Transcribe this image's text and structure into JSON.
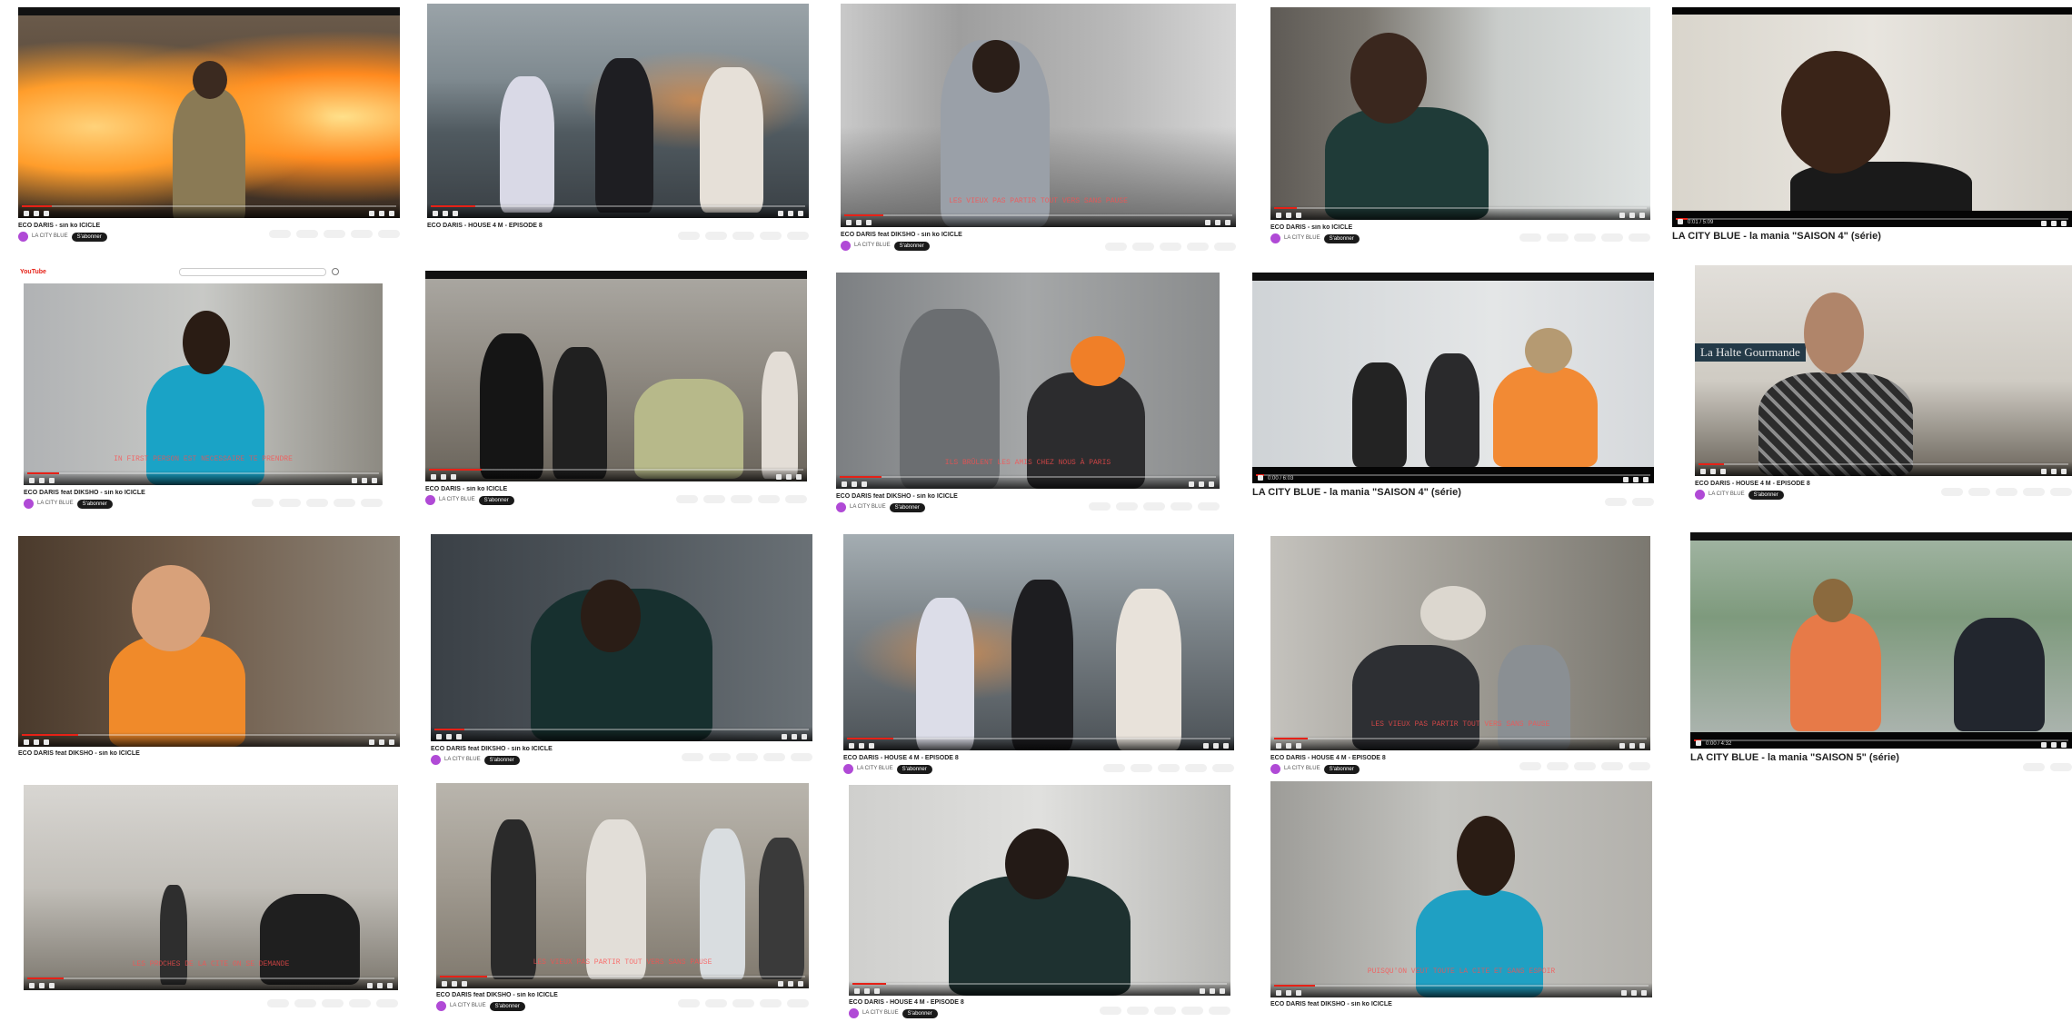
{
  "colors": {
    "progress": "#e62117",
    "subscribe": "#1a1a1a",
    "avatar": "#b04ad6",
    "caption": "#ff4d4d"
  },
  "search_bar": {
    "logo": "YouTube"
  },
  "videos": [
    {
      "title": "ECO DARIS - sin ko ICICLE",
      "channel": "LA CITY BLUE",
      "subscribe": "S'abonner",
      "caption": ""
    },
    {
      "title": "ECO DARIS - HOUSE 4 M - EPISODE 8",
      "channel": "",
      "subscribe": "",
      "caption": ""
    },
    {
      "title": "ECO DARIS feat DIKSHO - sin ko ICICLE",
      "channel": "LA CITY BLUE",
      "subscribe": "S'abonner",
      "caption": "LES VIEUX PAS PARTIR TOUT VERS SANS PAUSE"
    },
    {
      "title": "ECO DARIS - sin ko ICICLE",
      "channel": "LA CITY BLUE",
      "subscribe": "S'abonner",
      "caption": ""
    },
    {
      "title": "LA CITY BLUE - la mania \"SAISON 4\" (série)",
      "channel": "",
      "subscribe": "",
      "caption": "",
      "time": "0:01 / 5:09"
    },
    {
      "title": "ECO DARIS feat DIKSHO - sin ko ICICLE",
      "channel": "LA CITY BLUE",
      "subscribe": "S'abonner",
      "caption": "IN FIRST PERSON EST NÉCESSAIRE TE PRENDRE"
    },
    {
      "title": "ECO DARIS - sin ko ICICLE",
      "channel": "LA CITY BLUE",
      "subscribe": "S'abonner",
      "caption": ""
    },
    {
      "title": "ECO DARIS feat DIKSHO - sin ko ICICLE",
      "channel": "LA CITY BLUE",
      "subscribe": "S'abonner",
      "caption": "ILS BRÛLENT LES AMIS CHEZ NOUS À PARIS"
    },
    {
      "title": "LA CITY BLUE - la mania \"SAISON 4\" (série)",
      "channel": "",
      "subscribe": "",
      "caption": "",
      "time": "0:00 / 6:03"
    },
    {
      "title": "ECO DARIS - HOUSE 4 M - EPISODE 8",
      "channel": "LA CITY BLUE",
      "subscribe": "S'abonner",
      "caption": "",
      "sign": "La Halte Gourmande"
    },
    {
      "title": "ECO DARIS feat DIKSHO - sin ko ICICLE",
      "channel": "",
      "subscribe": "",
      "caption": ""
    },
    {
      "title": "ECO DARIS feat DIKSHO - sin ko ICICLE",
      "channel": "LA CITY BLUE",
      "subscribe": "S'abonner",
      "caption": ""
    },
    {
      "title": "ECO DARIS - HOUSE 4 M - EPISODE 8",
      "channel": "LA CITY BLUE",
      "subscribe": "S'abonner",
      "caption": ""
    },
    {
      "title": "ECO DARIS - HOUSE 4 M - EPISODE 8",
      "channel": "LA CITY BLUE",
      "subscribe": "S'abonner",
      "caption": "LES VIEUX PAS PARTIR TOUT VERS SANS PAUSE"
    },
    {
      "title": "LA CITY BLUE - la mania \"SAISON 5\" (série)",
      "channel": "",
      "subscribe": "",
      "caption": "",
      "time": "0:00 / 4:32"
    },
    {
      "title": "",
      "channel": "",
      "subscribe": "",
      "caption": "LES PROCHES DE LA CITÉ ON SE DEMANDE"
    },
    {
      "title": "ECO DARIS feat DIKSHO - sin ko ICICLE",
      "channel": "LA CITY BLUE",
      "subscribe": "S'abonner",
      "caption": "LES VIEUX PAS PARTIR TOUT VERS SANS PAUSE"
    },
    {
      "title": "ECO DARIS - HOUSE 4 M - EPISODE 8",
      "channel": "LA CITY BLUE",
      "subscribe": "S'abonner",
      "caption": ""
    },
    {
      "title": "ECO DARIS feat DIKSHO - sin ko ICICLE",
      "channel": "",
      "subscribe": "",
      "caption": "PUISQU'ON VEUT TOUTE LA CITÉ ET SANS ESPOIR"
    }
  ]
}
